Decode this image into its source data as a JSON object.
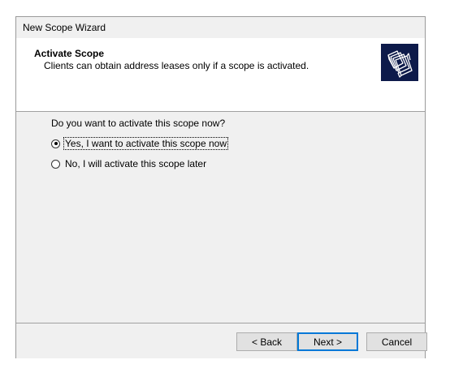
{
  "window": {
    "title": "New Scope Wizard"
  },
  "header": {
    "title": "Activate Scope",
    "subtitle": "Clients can obtain address leases only if a scope is activated."
  },
  "body": {
    "question": "Do you want to activate this scope now?",
    "options": [
      {
        "label": "Yes, I want to activate this scope now",
        "selected": true
      },
      {
        "label": "No, I will activate this scope later",
        "selected": false
      }
    ]
  },
  "buttons": {
    "back": "< Back",
    "next": "Next >",
    "cancel": "Cancel"
  },
  "colors": {
    "dialog_bg": "#f0f0f0",
    "header_bg": "#ffffff",
    "icon_bg": "#0d1a4a",
    "default_button_border": "#0078d7"
  },
  "icons": {
    "wizard": "scope-folders-icon"
  }
}
